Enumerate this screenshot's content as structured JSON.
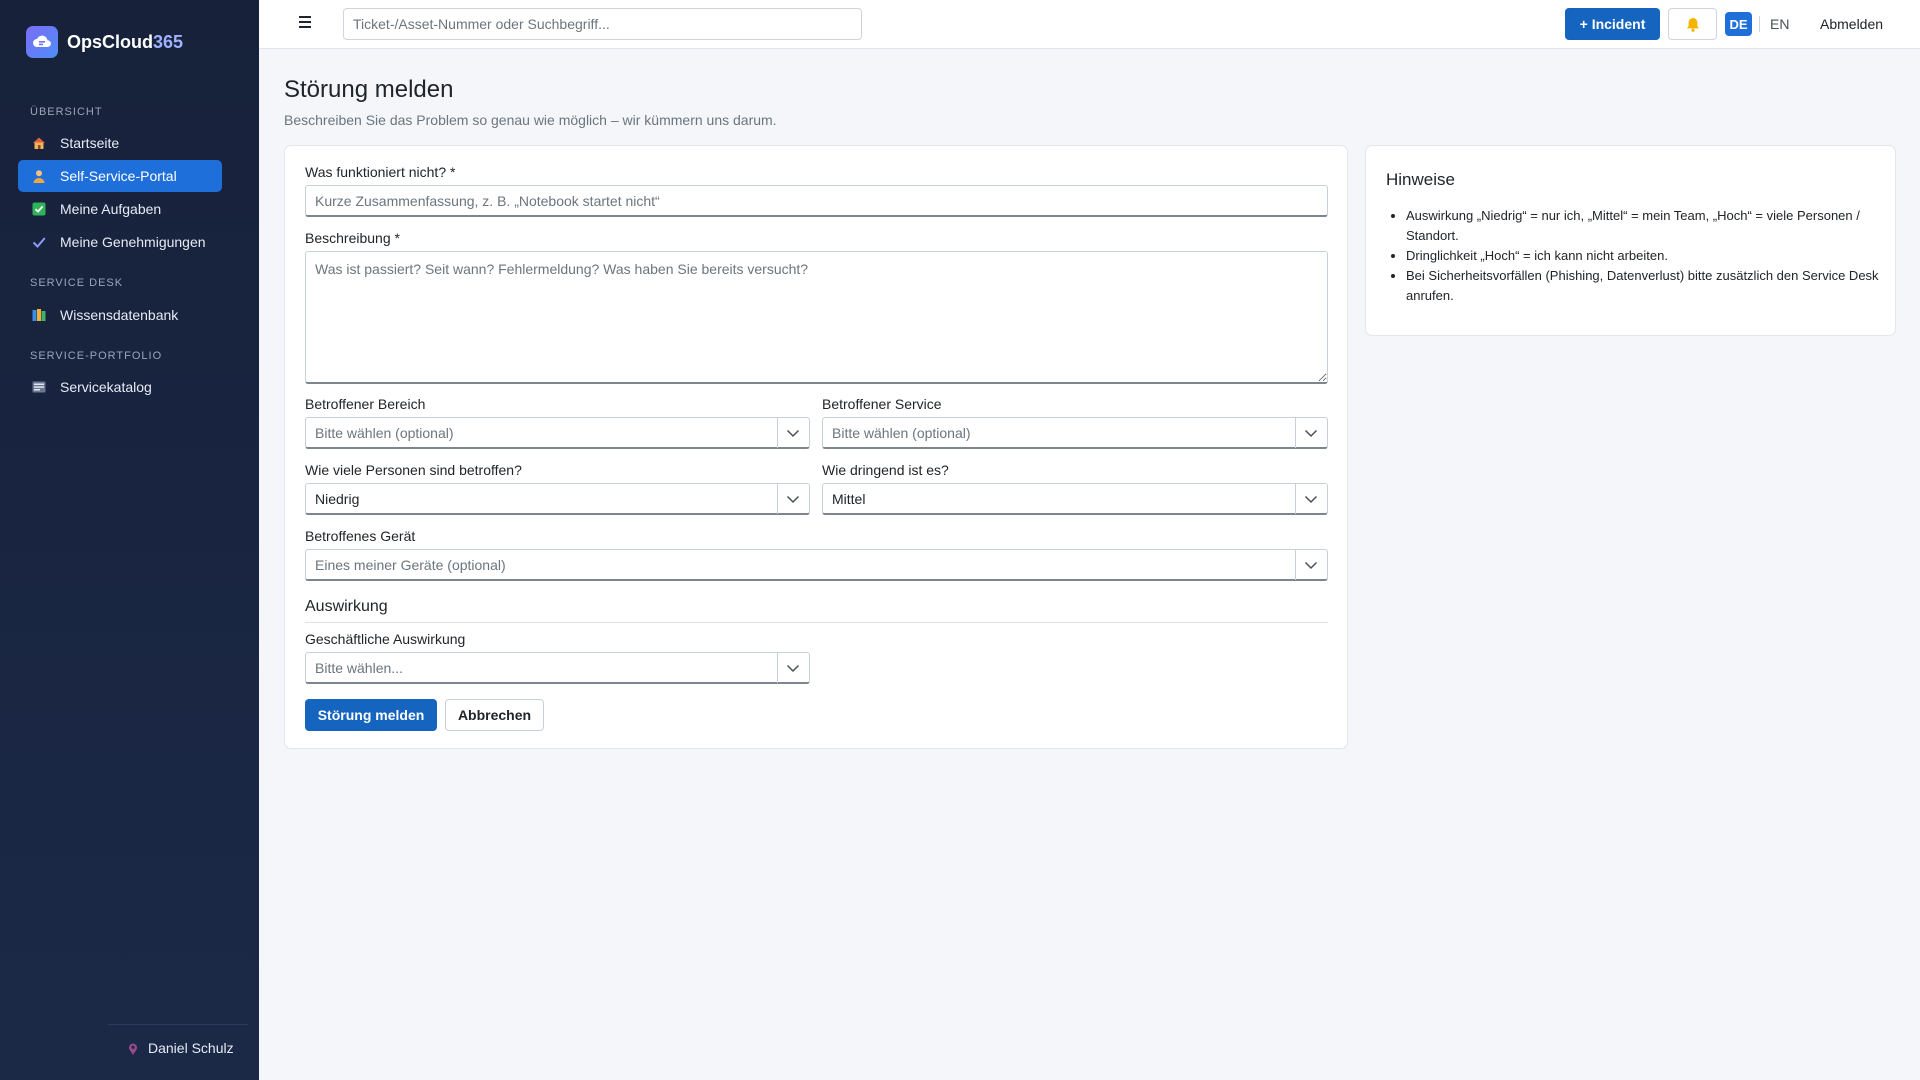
{
  "brand": {
    "name_main": "OpsCloud",
    "name_accent": "365"
  },
  "sidebar": {
    "sections": [
      {
        "label": "Übersicht"
      },
      {
        "label": "Service Desk"
      },
      {
        "label": "Service-Portfolio"
      }
    ],
    "items": [
      {
        "label": "Startseite",
        "icon": "house-icon"
      },
      {
        "label": "Self-Service-Portal",
        "icon": "person-icon",
        "active": true
      },
      {
        "label": "Meine Aufgaben",
        "icon": "checkbox-icon"
      },
      {
        "label": "Meine Genehmigungen",
        "icon": "checkmark-icon"
      },
      {
        "label": "Wissensdatenbank",
        "icon": "books-icon"
      },
      {
        "label": "Servicekatalog",
        "icon": "catalog-icon"
      }
    ],
    "user": {
      "name": "Daniel Schulz",
      "icon": "pin-icon"
    }
  },
  "topbar": {
    "search_placeholder": "Ticket-/Asset-Nummer oder Suchbegriff...",
    "incident_label": "+ Incident",
    "bell_icon": "bell-icon",
    "lang_de": "DE",
    "lang_en": "EN",
    "logout_label": "Abmelden"
  },
  "page": {
    "title": "Störung melden",
    "subtitle": "Beschreiben Sie das Problem so genau wie möglich – wir kümmern uns darum."
  },
  "form": {
    "summary": {
      "label": "Was funktioniert nicht? *",
      "placeholder": "Kurze Zusammenfassung, z. B. „Notebook startet nicht“",
      "value": ""
    },
    "description": {
      "label": "Beschreibung *",
      "placeholder": "Was ist passiert? Seit wann? Fehlermeldung? Was haben Sie bereits versucht?",
      "value": ""
    },
    "area": {
      "label": "Betroffener Bereich",
      "value": "Bitte wählen (optional)"
    },
    "service": {
      "label": "Betroffener Service",
      "value": "Bitte wählen (optional)"
    },
    "impact_people": {
      "label": "Wie viele Personen sind betroffen?",
      "value": "Niedrig"
    },
    "urgency": {
      "label": "Wie dringend ist es?",
      "value": "Mittel"
    },
    "device": {
      "label": "Betroffenes Gerät",
      "value": "Eines meiner Geräte (optional)"
    },
    "section_impact": "Auswirkung",
    "business_impact": {
      "label": "Geschäftliche Auswirkung",
      "value": "Bitte wählen..."
    },
    "submit_label": "Störung melden",
    "cancel_label": "Abbrechen"
  },
  "hints": {
    "title": "Hinweise",
    "items": [
      "Auswirkung „Niedrig“ = nur ich, „Mittel“ = mein Team, „Hoch“ = viele Personen / Standort.",
      "Dringlichkeit „Hoch“ = ich kann nicht arbeiten.",
      "Bei Sicherheitsvorfällen (Phishing, Datenverlust) bitte zusätzlich den Service Desk anrufen."
    ]
  },
  "colors": {
    "sidebar_bg": "#17213a",
    "accent": "#1e6fd9",
    "primary_button": "#1565c0",
    "page_bg": "#f4f6f9"
  }
}
